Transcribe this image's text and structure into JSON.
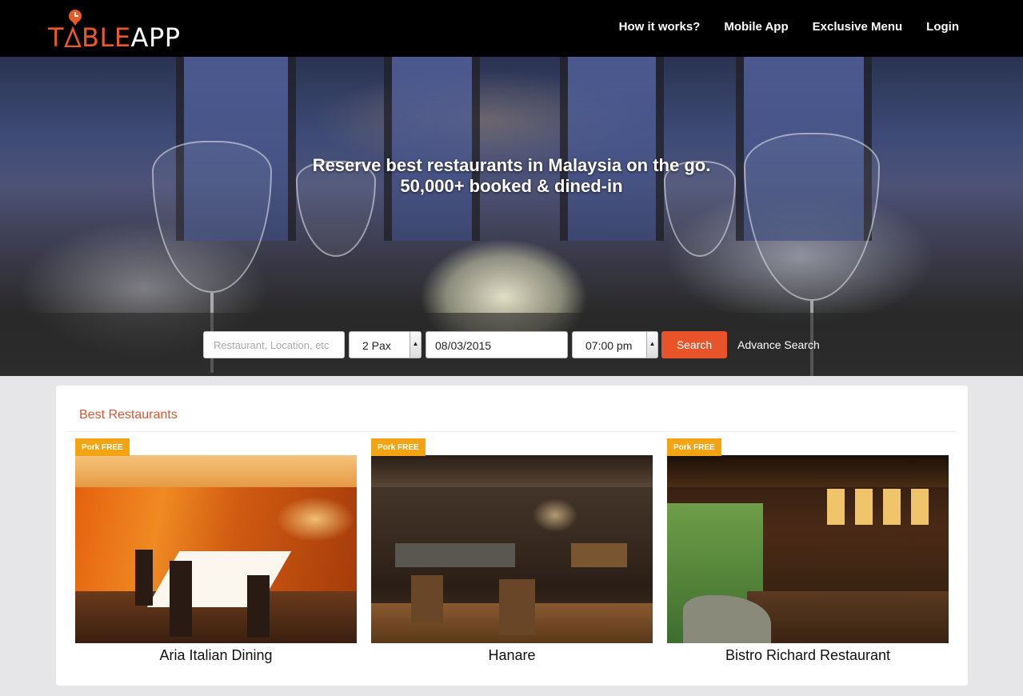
{
  "brand": {
    "logo_part1": "T",
    "logo_part2": "BLE",
    "logo_part3": "APP",
    "accent_color": "#e9532a",
    "badge_color": "#f2a413"
  },
  "nav": {
    "items": [
      {
        "label": "How it works?"
      },
      {
        "label": "Mobile App"
      },
      {
        "label": "Exclusive Menu"
      },
      {
        "label": "Login"
      }
    ]
  },
  "hero": {
    "title_line1": "Reserve best restaurants in Malaysia on the go.",
    "title_line2": "50,000+ booked & dined-in"
  },
  "search": {
    "placeholder": "Restaurant, Location, etc",
    "pax_value": "2 Pax",
    "date_value": "08/03/2015",
    "time_value": "07:00 pm",
    "search_label": "Search",
    "advance_label": "Advance Search"
  },
  "best": {
    "title": "Best Restaurants",
    "restaurants": [
      {
        "name": "Aria Italian Dining",
        "badge": "Pork FREE"
      },
      {
        "name": "Hanare",
        "badge": "Pork FREE"
      },
      {
        "name": "Bistro Richard Restaurant",
        "badge": "Pork FREE"
      }
    ]
  }
}
